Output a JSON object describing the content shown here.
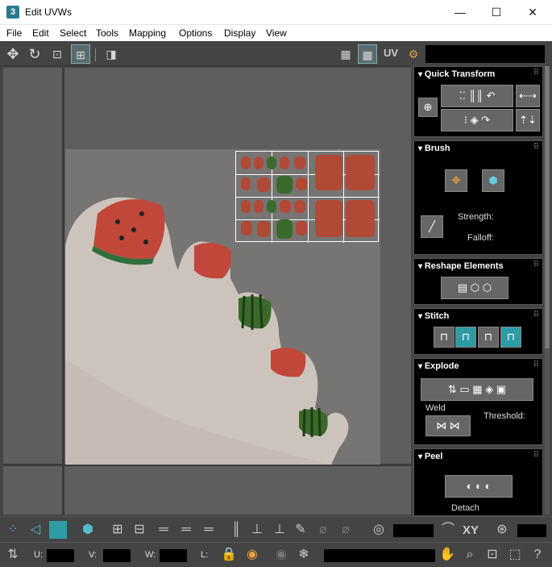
{
  "window": {
    "title": "Edit UVWs",
    "app_icon": "3",
    "minimize": "—",
    "maximize": "☐",
    "close": "✕"
  },
  "menu": [
    "File",
    "Edit",
    "Select",
    "Tools",
    "Mapping",
    "Options",
    "Display",
    "View"
  ],
  "toolbar": {
    "uv_label": "UV"
  },
  "rollouts": {
    "quick_transform": {
      "title": "Quick Transform"
    },
    "brush": {
      "title": "Brush",
      "strength_label": "Strength:",
      "falloff_label": "Falloff:"
    },
    "reshape": {
      "title": "Reshape Elements"
    },
    "stitch": {
      "title": "Stitch"
    },
    "explode": {
      "title": "Explode",
      "weld_label": "Weld",
      "threshold_label": "Threshold:"
    },
    "peel": {
      "title": "Peel",
      "detach_label": "Detach"
    }
  },
  "bottombar": {
    "xy_label": "XY",
    "u_label": "U:",
    "v_label": "V:",
    "w_label": "W:",
    "l_label": "L:"
  },
  "colors": {
    "accent": "#2e9ba5",
    "panel_bg": "#000000",
    "ui_bg": "#444444",
    "viewport_bg": "#5e5e5e"
  }
}
